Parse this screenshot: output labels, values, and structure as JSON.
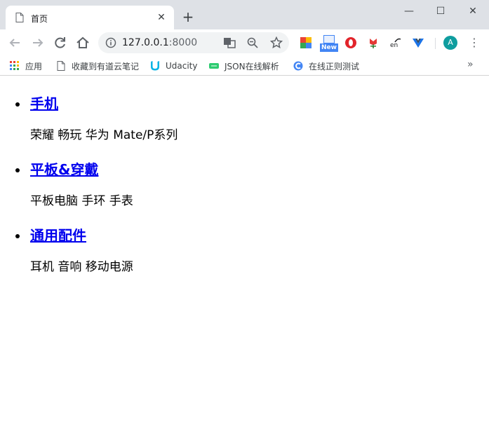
{
  "browser": {
    "tab_title": "首页",
    "tab_close": "✕",
    "new_tab": "+",
    "window": {
      "minimize": "—",
      "maximize": "☐",
      "close": "✕"
    },
    "url_host": "127.0.0.1",
    "url_port": ":8000",
    "ext_new_badge": "New",
    "profile_initial": "A",
    "menu": "⋮",
    "bookmarks": [
      {
        "label": "应用",
        "icon": "apps-grid-icon"
      },
      {
        "label": "收藏到有道云笔记",
        "icon": "page-icon"
      },
      {
        "label": "Udacity",
        "icon": "udacity-icon"
      },
      {
        "label": "JSON在线解析",
        "icon": "json-icon"
      },
      {
        "label": "在线正则测试",
        "icon": "regex-icon"
      }
    ],
    "bookmarks_more": "»"
  },
  "page": {
    "categories": [
      {
        "title": "手机",
        "items": "荣耀 畅玩 华为 Mate/P系列"
      },
      {
        "title": "平板&穿戴",
        "items": "平板电脑 手环 手表"
      },
      {
        "title": "通用配件",
        "items": "耳机 音响 移动电源"
      }
    ]
  }
}
